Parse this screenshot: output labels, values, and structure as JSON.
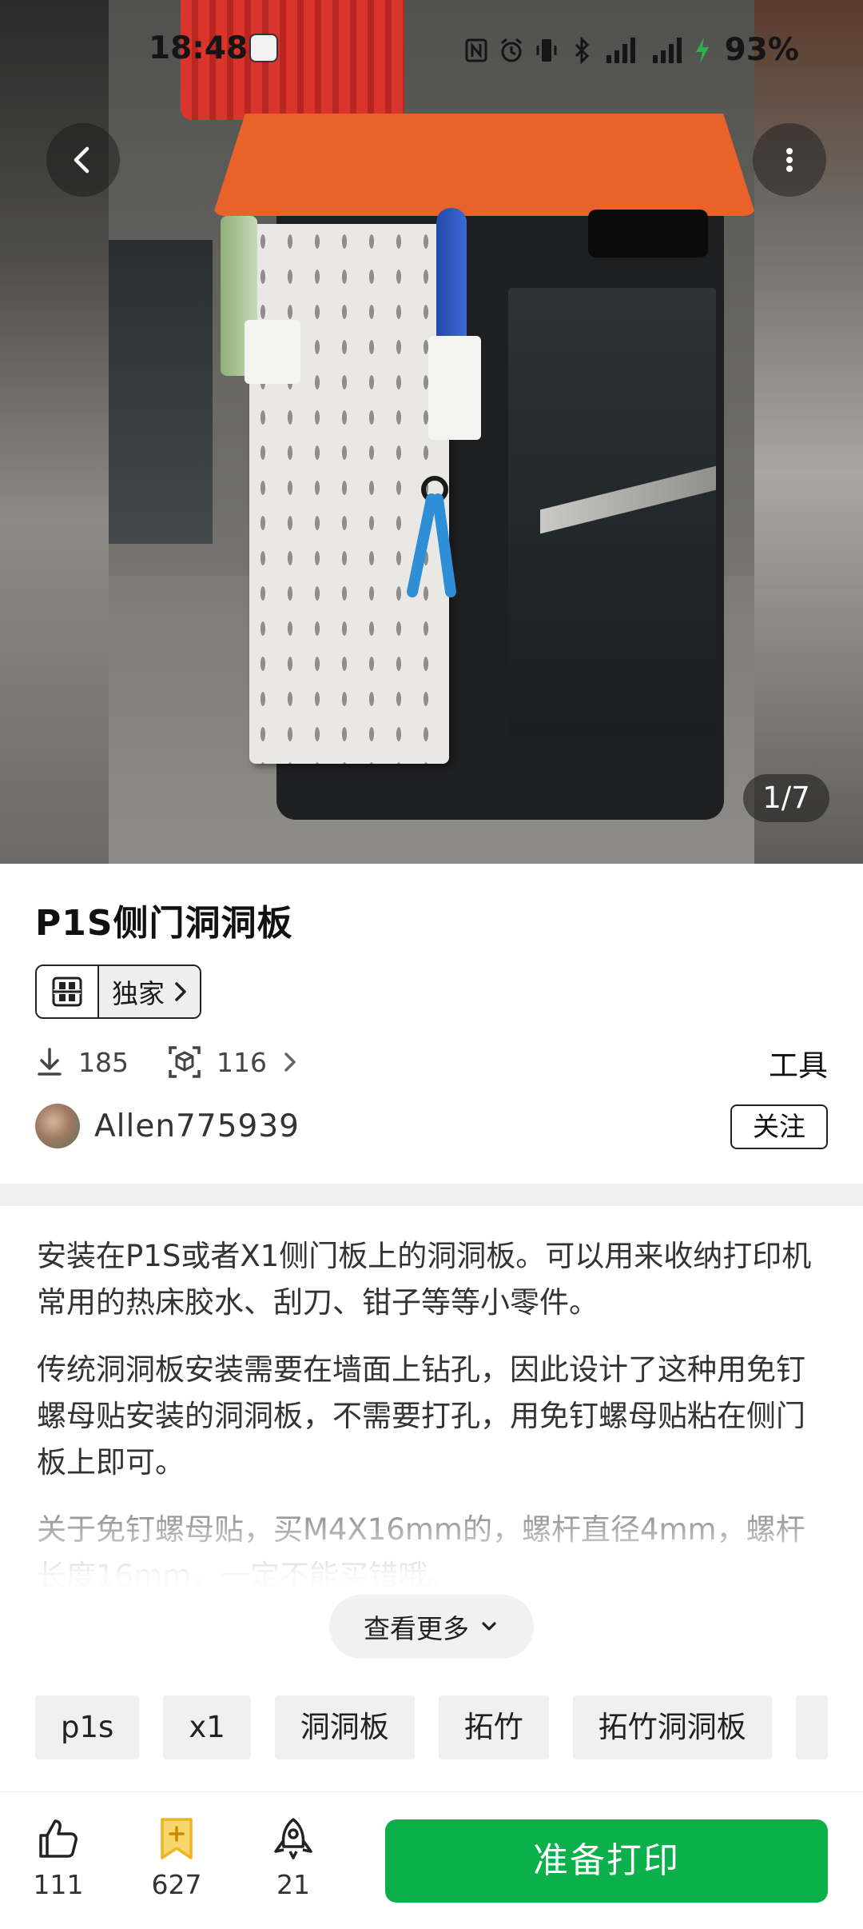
{
  "status_bar": {
    "time": "18:48",
    "battery": "93%",
    "icons": [
      "nfc-icon",
      "alarm-icon",
      "vibrate-icon",
      "bluetooth-icon",
      "signal-icon",
      "5g-signal-icon",
      "charging-icon"
    ]
  },
  "gallery": {
    "counter": "1/7",
    "back_icon": "chevron-left-icon",
    "more_icon": "more-vertical-icon"
  },
  "model": {
    "title": "P1S侧门洞洞板",
    "badge_label": "独家",
    "downloads": "185",
    "prints": "116",
    "category": "工具"
  },
  "author": {
    "name": "Allen775939",
    "follow_label": "关注"
  },
  "description": {
    "p1": "安装在P1S或者X1侧门板上的洞洞板。可以用来收纳打印机常用的热床胶水、刮刀、钳子等等小零件。",
    "p2": "传统洞洞板安装需要在墙面上钻孔，因此设计了这种用免钉螺母贴安装的洞洞板，不需要打孔，用免钉螺母贴粘在侧门板上即可。",
    "p3": "关于免钉螺母贴，买M4X16mm的，螺杆直径4mm，螺杆长度16mm，一定不能买错哦。",
    "more_label": "查看更多"
  },
  "tags": [
    "p1s",
    "x1",
    "洞洞板",
    "拓竹",
    "拓竹洞洞板"
  ],
  "bottom_bar": {
    "likes": "111",
    "collects": "627",
    "boosts": "21",
    "print_label": "准备打印"
  },
  "colors": {
    "primary_green": "#0cb04a",
    "collect_gold": "#f0b323"
  }
}
